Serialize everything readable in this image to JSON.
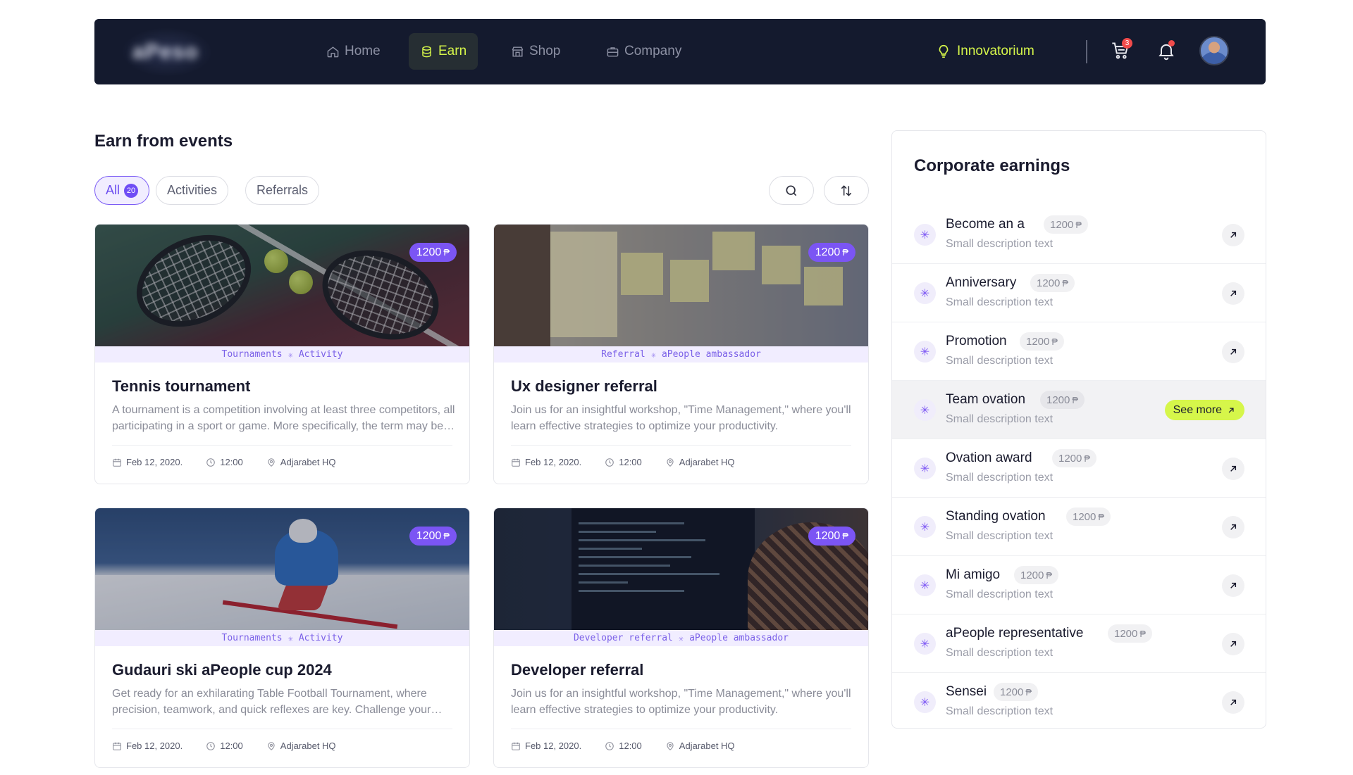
{
  "nav": {
    "logo": "aPeso",
    "items": [
      {
        "label": "Home",
        "icon": "home-icon"
      },
      {
        "label": "Earn",
        "icon": "coins-icon"
      },
      {
        "label": "Shop",
        "icon": "store-icon"
      },
      {
        "label": "Company",
        "icon": "briefcase-icon"
      }
    ],
    "active": "Earn",
    "innovatorium": "Innovatorium",
    "cart_count": "3",
    "accent": "#d6f64a"
  },
  "main": {
    "title": "Earn from events",
    "filters": [
      {
        "label": "All",
        "count": "20"
      },
      {
        "label": "Activities"
      },
      {
        "label": "Referrals"
      }
    ],
    "cards": [
      {
        "price": "1200",
        "tags": [
          "Tournaments",
          "Activity"
        ],
        "title": "Tennis tournament",
        "desc": "A tournament is a competition involving at least three competitors, all participating in a sport or game. More specifically, the term may be used in either of two overlapping senses.",
        "date": "Feb 12, 2020.",
        "time": "12:00",
        "location": "Adjarabet HQ"
      },
      {
        "price": "1200",
        "tags": [
          "Referral",
          "aPeople ambassador"
        ],
        "title": "Ux designer referral",
        "desc": "Join us for an insightful workshop, \"Time Management,\" where you'll learn effective strategies to optimize your productivity.",
        "date": "Feb 12, 2020.",
        "time": "12:00",
        "location": "Adjarabet HQ"
      },
      {
        "price": "1200",
        "tags": [
          "Tournaments",
          "Activity"
        ],
        "title": "Gudauri ski aPeople cup 2024",
        "desc": "Get ready for an exhilarating Table Football Tournament, where precision, teamwork, and quick reflexes are key. Challenge your colleagues.",
        "date": "Feb 12, 2020.",
        "time": "12:00",
        "location": "Adjarabet HQ"
      },
      {
        "price": "1200",
        "tags": [
          "Developer referral",
          "aPeople ambassador"
        ],
        "title": "Developer referral",
        "desc": "Join us for an insightful workshop, \"Time Management,\" where you'll learn effective strategies to optimize your productivity.",
        "date": "Feb 12, 2020.",
        "time": "12:00",
        "location": "Adjarabet HQ"
      }
    ]
  },
  "panel": {
    "title": "Corporate earnings",
    "see_more": "See more",
    "items": [
      {
        "title": "Become  an a",
        "price": "1200",
        "desc": "Small description text"
      },
      {
        "title": "Anniversary",
        "price": "1200",
        "desc": "Small description text"
      },
      {
        "title": "Promotion",
        "price": "1200",
        "desc": "Small description text"
      },
      {
        "title": "Team ovation",
        "price": "1200",
        "desc": "Small description text"
      },
      {
        "title": "Ovation award",
        "price": "1200",
        "desc": "Small description text"
      },
      {
        "title": "Standing ovation",
        "price": "1200",
        "desc": "Small description text"
      },
      {
        "title": "Mi amigo",
        "price": "1200",
        "desc": "Small description text"
      },
      {
        "title": "aPeople representative",
        "price": "1200",
        "desc": "Small description text"
      },
      {
        "title": "Sensei",
        "price": "1200",
        "desc": "Small description text"
      }
    ],
    "highlighted_index": 3
  }
}
